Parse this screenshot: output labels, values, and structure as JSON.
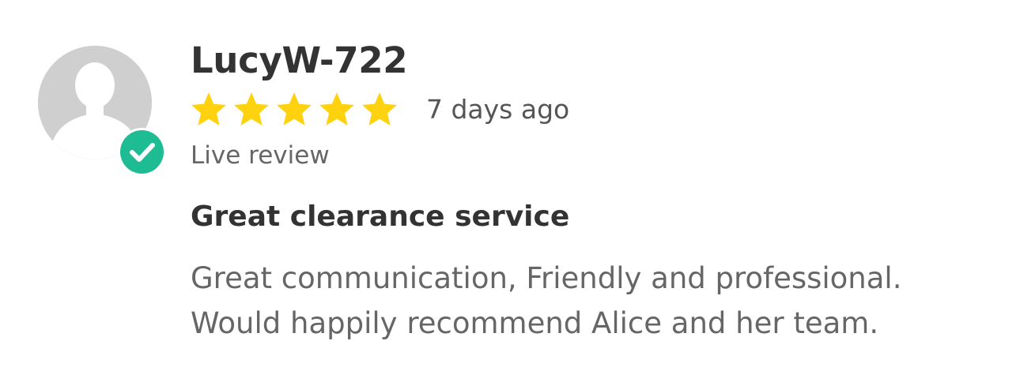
{
  "review": {
    "username": "LucyW-722",
    "rating": 5,
    "rating_max": 5,
    "time_ago": "7 days ago",
    "status": "Live review",
    "title": "Great clearance service",
    "body_lines": [
      "Great communication, Friendly and professional.",
      "Would happily recommend Alice and her team."
    ]
  },
  "icons": {
    "avatar": "user-silhouette-icon",
    "badge": "checkmark-icon",
    "star": "star-icon"
  },
  "colors": {
    "star": "#ffd20f",
    "verified_badge": "#1ebc93",
    "avatar_bg": "#cfcfcf"
  }
}
